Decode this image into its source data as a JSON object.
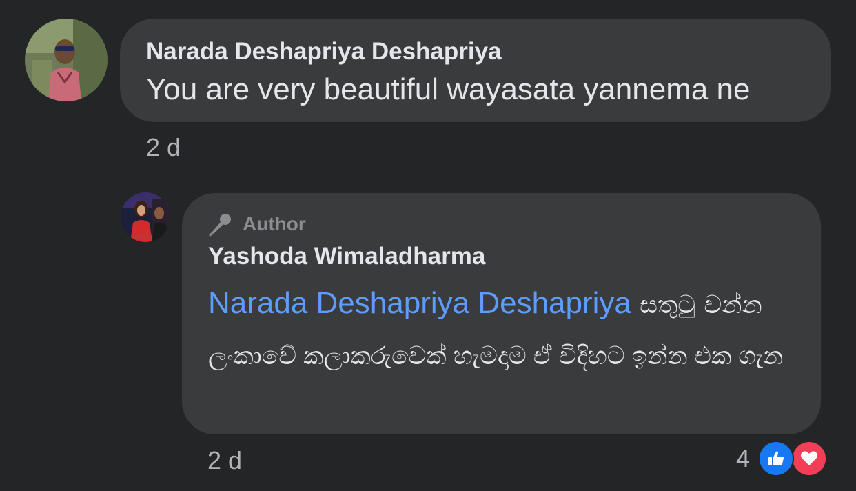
{
  "comment": {
    "author": "Narada Deshapriya Deshapriya",
    "text": "You are very beautiful wayasata yannema ne",
    "timestamp": "2 d",
    "avatar_icon": "user-avatar-photo"
  },
  "reply": {
    "badge_label": "Author",
    "badge_icon": "microphone-icon",
    "author": "Yashoda Wimaladharma",
    "mention": "Narada Deshapriya Deshapriya",
    "text_part1": "සතුටු",
    "text_part2": "වන්න ලංකාවේ කලාකරුවෙක් හැමදාම ඒ විදිහට ඉන්න එක ගැන",
    "timestamp": "2 d",
    "reactions": {
      "count": "4",
      "types": [
        "like-icon",
        "love-icon"
      ],
      "like_color": "#1877f2",
      "love_color": "#f33e58"
    },
    "avatar_icon": "author-avatar-photo"
  },
  "colors": {
    "background": "#242526",
    "bubble": "#3a3b3c",
    "text": "#e4e6eb",
    "secondary_text": "#b0b3b8",
    "mention": "#5c9dff"
  }
}
